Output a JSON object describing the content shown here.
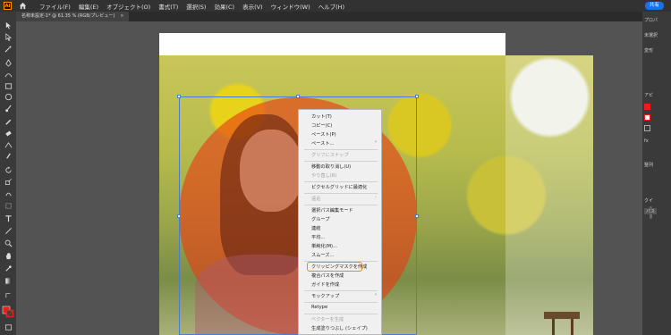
{
  "app": {
    "logo_text": "Ai"
  },
  "menubar": {
    "items": [
      "ファイル(F)",
      "編集(E)",
      "オブジェクト(O)",
      "書式(T)",
      "選択(S)",
      "効果(C)",
      "表示(V)",
      "ウィンドウ(W)",
      "ヘルプ(H)"
    ],
    "share_label": "共有"
  },
  "document_tab": {
    "title": "名称未設定-1* @ 61.35 % (RGB/プレビュー)",
    "close": "×"
  },
  "right_dock": {
    "labels": [
      "プロパ",
      "未選択",
      "変形",
      "アピ",
      "fx",
      "整列",
      "クイ",
      "パス"
    ]
  },
  "context_menu": {
    "items": [
      {
        "label": "カット(T)",
        "enabled": true
      },
      {
        "label": "コピー(C)",
        "enabled": true
      },
      {
        "label": "ペースト(P)",
        "enabled": true
      },
      {
        "label": "ペースト...",
        "enabled": true,
        "submenu": true
      },
      {
        "label": "グリフにスナップ",
        "enabled": false
      },
      {
        "label": "移動の取り消し(U)",
        "enabled": true
      },
      {
        "label": "やり直し(R)",
        "enabled": false
      },
      {
        "label": "ピクセルグリッドに最適化",
        "enabled": true
      },
      {
        "label": "遠近",
        "enabled": false,
        "submenu": true
      },
      {
        "label": "選択パス編集モード",
        "enabled": true
      },
      {
        "label": "グループ",
        "enabled": true
      },
      {
        "label": "連結",
        "enabled": true
      },
      {
        "label": "平均...",
        "enabled": true
      },
      {
        "label": "単純化(M)...",
        "enabled": true
      },
      {
        "label": "スムーズ...",
        "enabled": true
      },
      {
        "label": "クリッピングマスクを作成",
        "enabled": true,
        "highlighted": true
      },
      {
        "label": "複合パスを作成",
        "enabled": true
      },
      {
        "label": "ガイドを作成",
        "enabled": true
      },
      {
        "label": "モックアップ",
        "enabled": true,
        "submenu": true
      },
      {
        "label": "Retype",
        "enabled": true
      },
      {
        "label": "ベクターを生成",
        "enabled": false
      },
      {
        "label": "生成塗りつぶし (シェイプ)",
        "enabled": true
      }
    ]
  },
  "colors": {
    "accent_blue": "#1473e6",
    "selection_blue": "#4a7bd6",
    "circle_fill": "#e83c14",
    "highlight_orange": "#f0861c",
    "fill_swatch": "#e81f1f"
  },
  "icons": [
    "home-icon",
    "selection-tool-icon",
    "direct-selection-tool-icon",
    "magic-wand-icon",
    "lasso-icon",
    "pen-tool-icon",
    "type-tool-icon",
    "line-tool-icon",
    "rectangle-tool-icon",
    "ellipse-tool-icon",
    "paintbrush-icon",
    "pencil-icon",
    "eraser-icon",
    "rotate-icon",
    "scale-icon",
    "width-tool-icon",
    "shape-builder-icon",
    "gradient-icon",
    "eyedropper-icon",
    "hand-icon",
    "zoom-icon",
    "fill-stroke-icon"
  ]
}
